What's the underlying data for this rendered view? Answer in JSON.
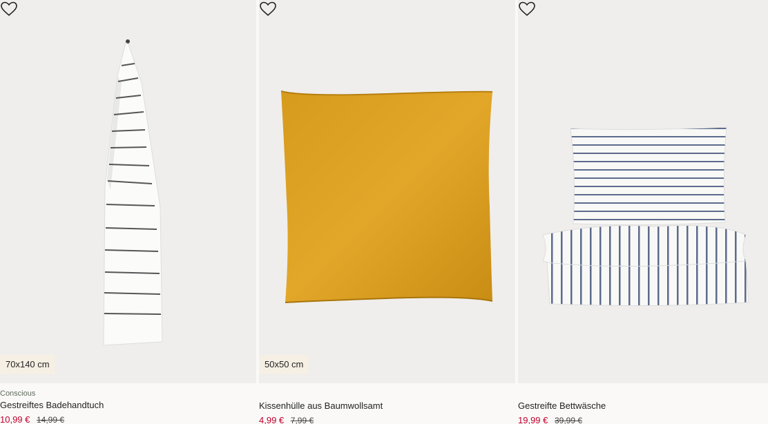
{
  "products": [
    {
      "tag": "Conscious",
      "name": "Gestreiftes Badehandtuch",
      "size_badge": "70x140 cm",
      "price_sale": "10,99 €",
      "price_old": "14,99 €",
      "image_subject": "striped-towel"
    },
    {
      "tag": "",
      "name": "Kissenhülle aus Baumwollsamt",
      "size_badge": "50x50 cm",
      "price_sale": "4,99 €",
      "price_old": "7,99 €",
      "image_subject": "yellow-velvet-cushion"
    },
    {
      "tag": "",
      "name": "Gestreifte Bettwäsche",
      "size_badge": "",
      "price_sale": "19,99 €",
      "price_old": "39,99 €",
      "image_subject": "striped-bed-linen"
    }
  ],
  "colors": {
    "sale": "#c0002a",
    "badge_bg": "#f6efe4",
    "image_bg": "#efeeec"
  },
  "icons": {
    "favorite": "heart-outline-icon"
  }
}
